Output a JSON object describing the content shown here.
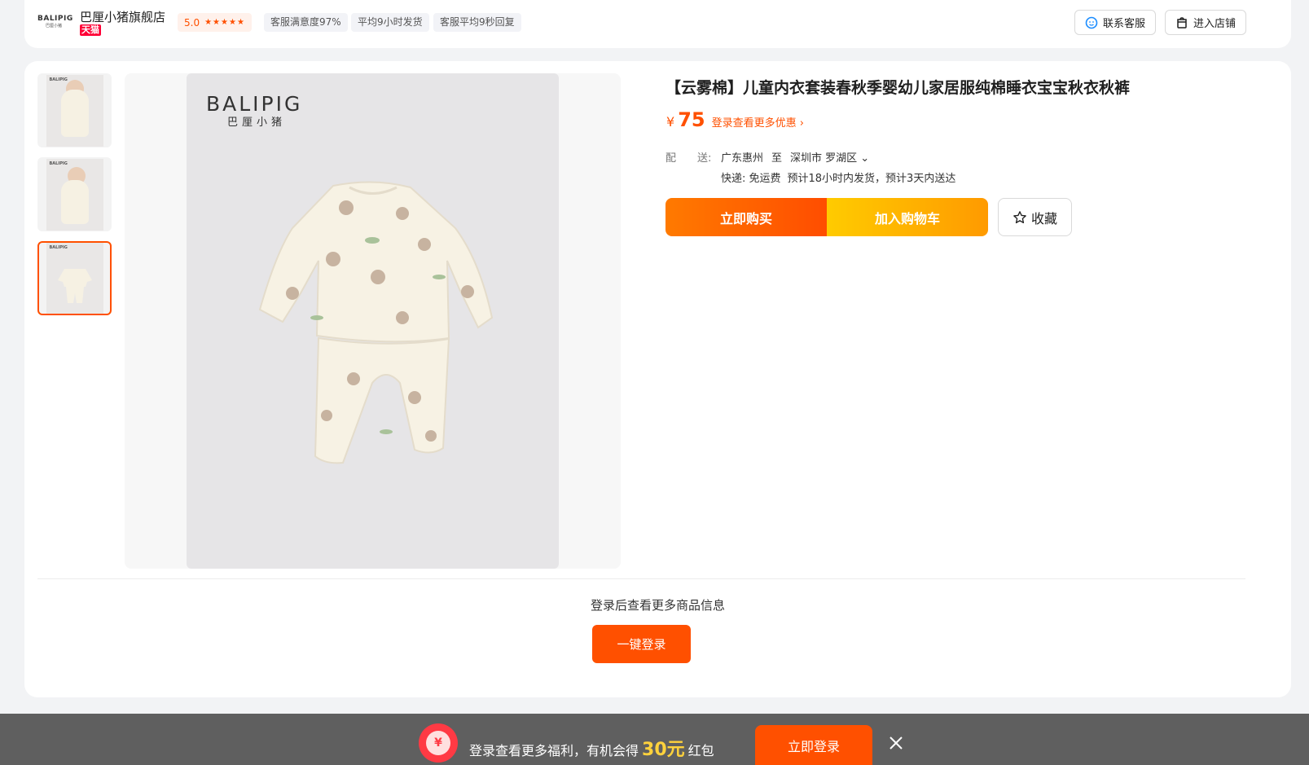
{
  "store": {
    "logo_text": "BALIPIG",
    "logo_sub": "巴厘小猪",
    "name": "巴厘小猪旗舰店",
    "badge": "天猫",
    "rating": "5.0",
    "stars": "★★★★★",
    "meta": [
      "客服满意度97%",
      "平均9小时发货",
      "客服平均9秒回复"
    ],
    "contact_label": "联系客服",
    "enter_label": "进入店铺"
  },
  "gallery": {
    "thumbs": [
      "thumb-1",
      "thumb-2",
      "thumb-3"
    ],
    "active_index": 2,
    "image_logo": "BALIPIG",
    "image_logo_sub": "巴厘小猪"
  },
  "product": {
    "title": "【云雾棉】儿童内衣套装春秋季婴幼儿家居服纯棉睡衣宝宝秋衣秋裤",
    "currency": "¥",
    "price": "75",
    "promo_link": "登录查看更多优惠 ›",
    "shipping_label": "配　　送:",
    "ship_from": "广东惠州",
    "ship_to_word": "至",
    "ship_to": "深圳市 罗湖区 ⌄",
    "express": "快递: 免运费",
    "estimate": "预计18小时内发货，预计3天内送达",
    "buy_label": "立即购买",
    "cart_label": "加入购物车",
    "fav_label": "收藏"
  },
  "login_section": {
    "text": "登录后查看更多商品信息",
    "button": "一键登录"
  },
  "promo_bar": {
    "icon_symbol": "¥",
    "text_before": "登录查看更多福利，有机会得",
    "amount": "30元",
    "text_after": "红包",
    "button": "立即登录"
  },
  "colors": {
    "accent": "#ff5000",
    "cart": "#ffb400",
    "badge": "#ff0036",
    "promo_bg": "#5f5f5f"
  }
}
